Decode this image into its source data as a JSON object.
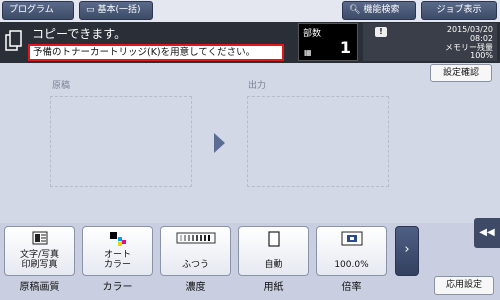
{
  "topbar": {
    "program_label": "プログラム",
    "basic_label": "基本(一括)",
    "function_search_label": "機能検索",
    "job_display_label": "ジョブ表示"
  },
  "status": {
    "title": "コピーできます。",
    "message": "予備のトナーカートリッジ(K)を用意してください。",
    "copies_label": "部数",
    "copies_value": "1",
    "date": "2015/03/20",
    "time": "08:02",
    "memory_label": "メモリー残量",
    "memory_value": "100%"
  },
  "main": {
    "confirm_label": "設定確認",
    "original_label": "原稿",
    "output_label": "出力"
  },
  "functions": [
    {
      "value": "文字/写真\n印刷写真",
      "caption": "原稿画質",
      "icon": "document-quality-icon"
    },
    {
      "value": "オート\nカラー",
      "caption": "カラー",
      "icon": "color-icon"
    },
    {
      "value": "ふつう",
      "caption": "濃度",
      "icon": "density-icon"
    },
    {
      "value": "自動",
      "caption": "用紙",
      "icon": "paper-icon"
    },
    {
      "value": "100.0%",
      "caption": "倍率",
      "icon": "zoom-icon"
    }
  ],
  "bottom": {
    "apply_label": "応用設定",
    "more_icon": "chevron-right-icon",
    "side_icon": "double-chevron-left-icon"
  },
  "colors": {
    "accent": "#3d4b68",
    "alert_border": "#e01818"
  }
}
